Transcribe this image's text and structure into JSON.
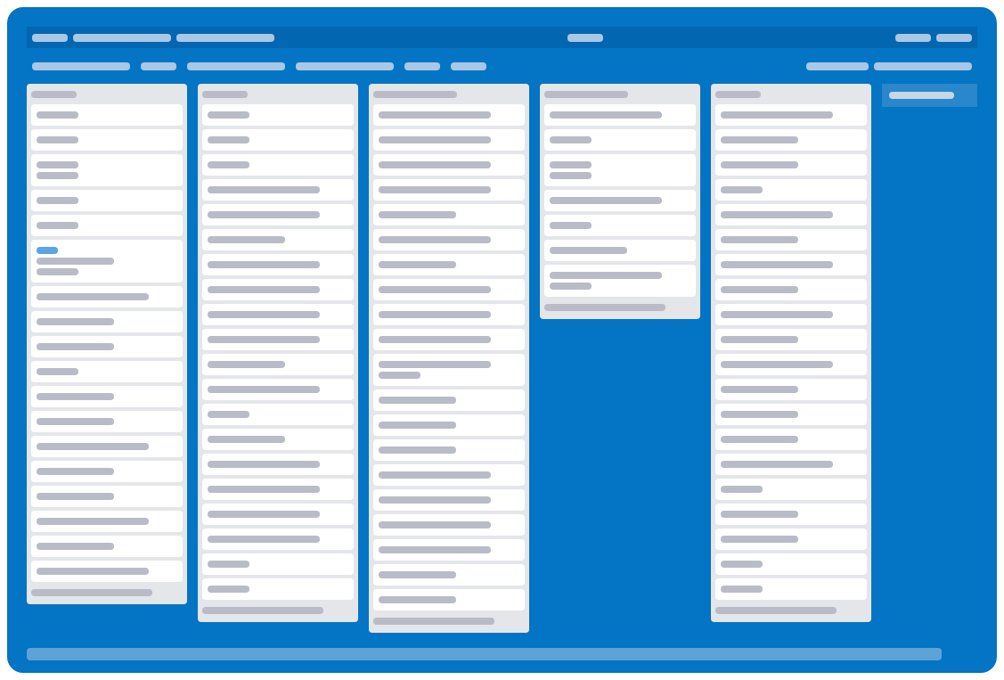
{
  "header": {
    "left": [
      {
        "kind": "short"
      },
      {
        "kind": "long"
      },
      {
        "kind": "long"
      }
    ],
    "center": [
      {
        "kind": "short"
      }
    ],
    "right": [
      {
        "kind": "short"
      },
      {
        "kind": "short"
      }
    ]
  },
  "toolbar": {
    "left": [
      {
        "kind": "long"
      },
      {
        "kind": "short"
      },
      {
        "kind": "long"
      },
      {
        "kind": "long"
      },
      {
        "kind": "short"
      },
      {
        "kind": "short"
      }
    ],
    "right": [
      {
        "kind": "medium"
      },
      {
        "kind": "long"
      }
    ]
  },
  "lists": [
    {
      "title": {
        "kind": "short"
      },
      "cards": [
        {
          "lines": [
            {
              "kind": "short"
            }
          ]
        },
        {
          "lines": [
            {
              "kind": "short"
            }
          ]
        },
        {
          "lines": [
            {
              "kind": "short"
            },
            {
              "kind": "short"
            }
          ]
        },
        {
          "lines": [
            {
              "kind": "short"
            }
          ]
        },
        {
          "lines": [
            {
              "kind": "short"
            }
          ]
        },
        {
          "lines": [
            {
              "kind": "medium"
            },
            {
              "kind": "short"
            }
          ],
          "color": "#5ba4e5"
        },
        {
          "lines": [
            {
              "kind": "long"
            }
          ]
        },
        {
          "lines": [
            {
              "kind": "medium"
            }
          ]
        },
        {
          "lines": [
            {
              "kind": "medium"
            }
          ]
        },
        {
          "lines": [
            {
              "kind": "short"
            }
          ]
        },
        {
          "lines": [
            {
              "kind": "medium"
            }
          ]
        },
        {
          "lines": [
            {
              "kind": "medium"
            }
          ]
        },
        {
          "lines": [
            {
              "kind": "long"
            }
          ]
        },
        {
          "lines": [
            {
              "kind": "medium"
            }
          ]
        },
        {
          "lines": [
            {
              "kind": "medium"
            }
          ]
        },
        {
          "lines": [
            {
              "kind": "long"
            }
          ]
        },
        {
          "lines": [
            {
              "kind": "medium"
            }
          ]
        },
        {
          "lines": [
            {
              "kind": "long"
            }
          ]
        }
      ],
      "footer": {
        "kind": "long"
      }
    },
    {
      "title": {
        "kind": "short"
      },
      "cards": [
        {
          "lines": [
            {
              "kind": "short"
            }
          ]
        },
        {
          "lines": [
            {
              "kind": "short"
            }
          ]
        },
        {
          "lines": [
            {
              "kind": "short"
            }
          ]
        },
        {
          "lines": [
            {
              "kind": "long"
            }
          ]
        },
        {
          "lines": [
            {
              "kind": "long"
            }
          ]
        },
        {
          "lines": [
            {
              "kind": "medium"
            }
          ]
        },
        {
          "lines": [
            {
              "kind": "long"
            }
          ]
        },
        {
          "lines": [
            {
              "kind": "long"
            }
          ]
        },
        {
          "lines": [
            {
              "kind": "long"
            }
          ]
        },
        {
          "lines": [
            {
              "kind": "long"
            }
          ]
        },
        {
          "lines": [
            {
              "kind": "medium"
            }
          ]
        },
        {
          "lines": [
            {
              "kind": "long"
            }
          ]
        },
        {
          "lines": [
            {
              "kind": "short"
            }
          ]
        },
        {
          "lines": [
            {
              "kind": "medium"
            }
          ]
        },
        {
          "lines": [
            {
              "kind": "long"
            }
          ]
        },
        {
          "lines": [
            {
              "kind": "long"
            }
          ]
        },
        {
          "lines": [
            {
              "kind": "long"
            }
          ]
        },
        {
          "lines": [
            {
              "kind": "long"
            }
          ]
        },
        {
          "lines": [
            {
              "kind": "short"
            }
          ]
        },
        {
          "lines": [
            {
              "kind": "short"
            }
          ]
        }
      ],
      "footer": {
        "kind": "long"
      }
    },
    {
      "title": {
        "kind": "medium"
      },
      "cards": [
        {
          "lines": [
            {
              "kind": "long"
            }
          ]
        },
        {
          "lines": [
            {
              "kind": "long"
            }
          ]
        },
        {
          "lines": [
            {
              "kind": "long"
            }
          ]
        },
        {
          "lines": [
            {
              "kind": "long"
            }
          ]
        },
        {
          "lines": [
            {
              "kind": "medium"
            }
          ]
        },
        {
          "lines": [
            {
              "kind": "long"
            }
          ]
        },
        {
          "lines": [
            {
              "kind": "medium"
            }
          ]
        },
        {
          "lines": [
            {
              "kind": "long"
            }
          ]
        },
        {
          "lines": [
            {
              "kind": "long"
            }
          ]
        },
        {
          "lines": [
            {
              "kind": "long"
            }
          ]
        },
        {
          "lines": [
            {
              "kind": "long"
            },
            {
              "kind": "short"
            }
          ]
        },
        {
          "lines": [
            {
              "kind": "medium"
            }
          ]
        },
        {
          "lines": [
            {
              "kind": "medium"
            }
          ]
        },
        {
          "lines": [
            {
              "kind": "medium"
            }
          ]
        },
        {
          "lines": [
            {
              "kind": "long"
            }
          ]
        },
        {
          "lines": [
            {
              "kind": "long"
            }
          ]
        },
        {
          "lines": [
            {
              "kind": "long"
            }
          ]
        },
        {
          "lines": [
            {
              "kind": "long"
            }
          ]
        },
        {
          "lines": [
            {
              "kind": "medium"
            }
          ]
        },
        {
          "lines": [
            {
              "kind": "medium"
            }
          ]
        }
      ],
      "footer": {
        "kind": "long"
      }
    },
    {
      "title": {
        "kind": "medium"
      },
      "cards": [
        {
          "lines": [
            {
              "kind": "long"
            }
          ]
        },
        {
          "lines": [
            {
              "kind": "short"
            }
          ]
        },
        {
          "lines": [
            {
              "kind": "short"
            },
            {
              "kind": "short"
            }
          ]
        },
        {
          "lines": [
            {
              "kind": "long"
            }
          ]
        },
        {
          "lines": [
            {
              "kind": "short"
            }
          ]
        },
        {
          "lines": [
            {
              "kind": "medium"
            }
          ]
        },
        {
          "lines": [
            {
              "kind": "long"
            },
            {
              "kind": "short"
            }
          ]
        }
      ],
      "footer": {
        "kind": "long"
      }
    },
    {
      "title": {
        "kind": "short"
      },
      "cards": [
        {
          "lines": [
            {
              "kind": "long"
            }
          ]
        },
        {
          "lines": [
            {
              "kind": "medium"
            }
          ]
        },
        {
          "lines": [
            {
              "kind": "medium"
            }
          ]
        },
        {
          "lines": [
            {
              "kind": "short"
            }
          ]
        },
        {
          "lines": [
            {
              "kind": "long"
            }
          ]
        },
        {
          "lines": [
            {
              "kind": "medium"
            }
          ]
        },
        {
          "lines": [
            {
              "kind": "long"
            }
          ]
        },
        {
          "lines": [
            {
              "kind": "medium"
            }
          ]
        },
        {
          "lines": [
            {
              "kind": "long"
            }
          ]
        },
        {
          "lines": [
            {
              "kind": "medium"
            }
          ]
        },
        {
          "lines": [
            {
              "kind": "long"
            }
          ]
        },
        {
          "lines": [
            {
              "kind": "medium"
            }
          ]
        },
        {
          "lines": [
            {
              "kind": "medium"
            }
          ]
        },
        {
          "lines": [
            {
              "kind": "medium"
            }
          ]
        },
        {
          "lines": [
            {
              "kind": "long"
            }
          ]
        },
        {
          "lines": [
            {
              "kind": "short"
            }
          ]
        },
        {
          "lines": [
            {
              "kind": "medium"
            }
          ]
        },
        {
          "lines": [
            {
              "kind": "medium"
            }
          ]
        },
        {
          "lines": [
            {
              "kind": "short"
            }
          ]
        },
        {
          "lines": [
            {
              "kind": "short"
            }
          ]
        }
      ],
      "footer": {
        "kind": "long"
      }
    }
  ],
  "sidebar": {
    "block": {
      "kind": "long"
    }
  }
}
